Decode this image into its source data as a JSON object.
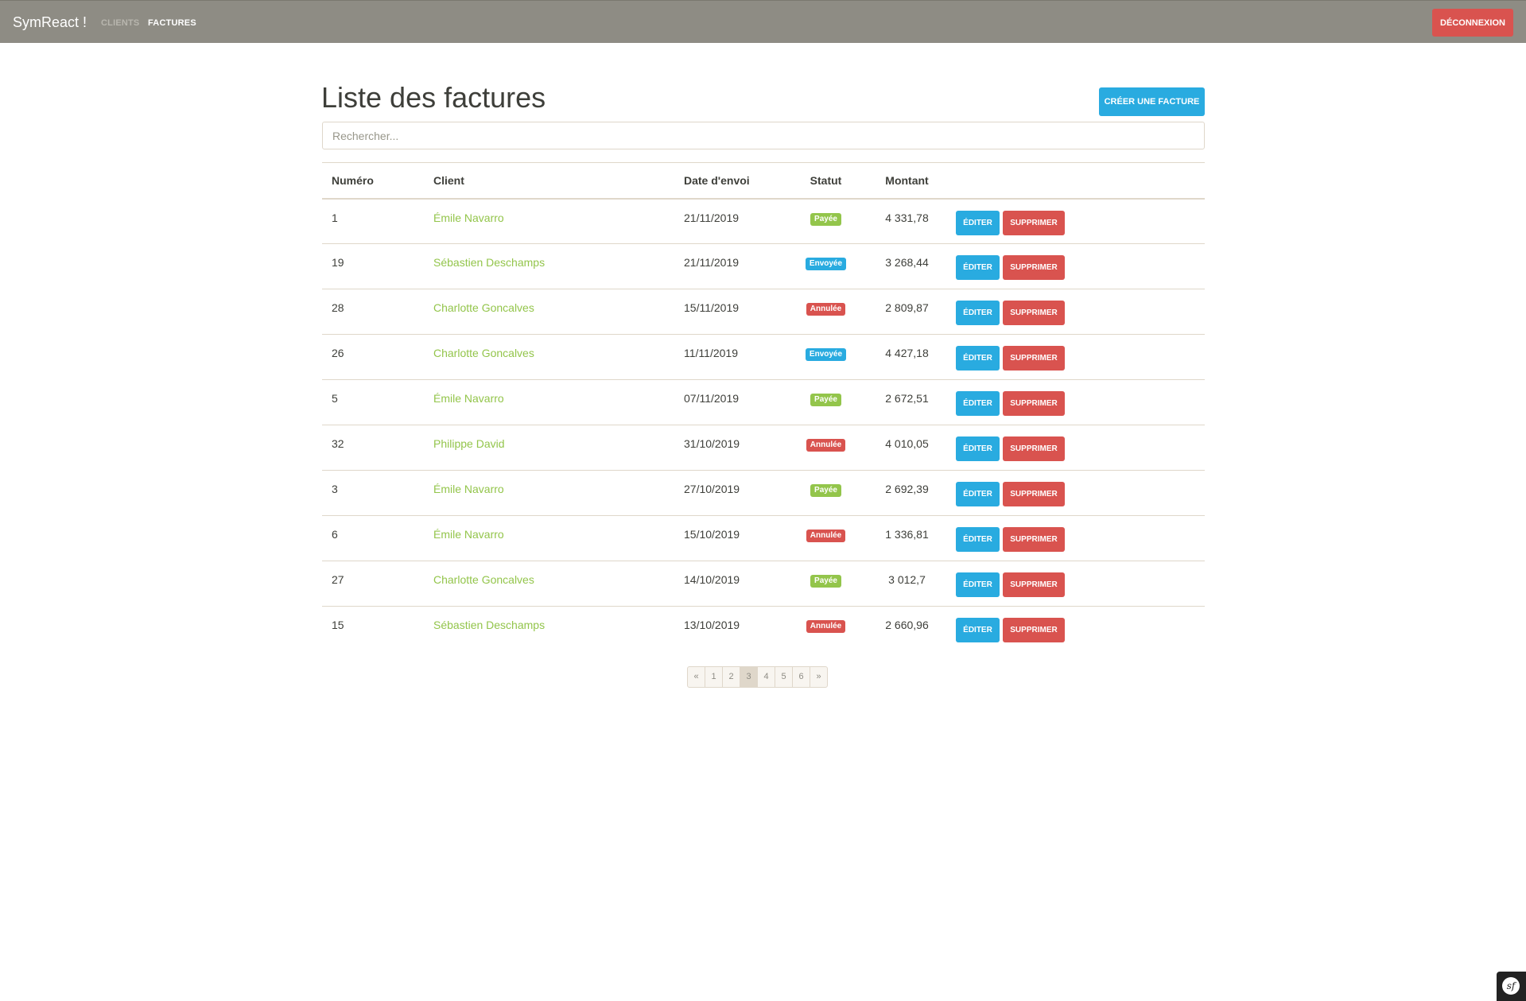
{
  "navbar": {
    "brand": "SymReact !",
    "links": [
      {
        "label": "Clients"
      },
      {
        "label": "Factures"
      }
    ],
    "logout_label": "Déconnexion"
  },
  "page": {
    "title": "Liste des factures",
    "create_label": "Créer une facture",
    "search_placeholder": "Rechercher..."
  },
  "table": {
    "headers": [
      "Numéro",
      "Client",
      "Date d'envoi",
      "Statut",
      "Montant",
      ""
    ],
    "edit_label": "Éditer",
    "delete_label": "Supprimer",
    "rows": [
      {
        "numero": "1",
        "client": "Émile Navarro",
        "date": "21/11/2019",
        "statut": "Payée",
        "statut_type": "paid",
        "montant": "4 331,78"
      },
      {
        "numero": "19",
        "client": "Sébastien Deschamps",
        "date": "21/11/2019",
        "statut": "Envoyée",
        "statut_type": "sent",
        "montant": "3 268,44"
      },
      {
        "numero": "28",
        "client": "Charlotte Goncalves",
        "date": "15/11/2019",
        "statut": "Annulée",
        "statut_type": "cancelled",
        "montant": "2 809,87"
      },
      {
        "numero": "26",
        "client": "Charlotte Goncalves",
        "date": "11/11/2019",
        "statut": "Envoyée",
        "statut_type": "sent",
        "montant": "4 427,18"
      },
      {
        "numero": "5",
        "client": "Émile Navarro",
        "date": "07/11/2019",
        "statut": "Payée",
        "statut_type": "paid",
        "montant": "2 672,51"
      },
      {
        "numero": "32",
        "client": "Philippe David",
        "date": "31/10/2019",
        "statut": "Annulée",
        "statut_type": "cancelled",
        "montant": "4 010,05"
      },
      {
        "numero": "3",
        "client": "Émile Navarro",
        "date": "27/10/2019",
        "statut": "Payée",
        "statut_type": "paid",
        "montant": "2 692,39"
      },
      {
        "numero": "6",
        "client": "Émile Navarro",
        "date": "15/10/2019",
        "statut": "Annulée",
        "statut_type": "cancelled",
        "montant": "1 336,81"
      },
      {
        "numero": "27",
        "client": "Charlotte Goncalves",
        "date": "14/10/2019",
        "statut": "Payée",
        "statut_type": "paid",
        "montant": "3 012,7"
      },
      {
        "numero": "15",
        "client": "Sébastien Deschamps",
        "date": "13/10/2019",
        "statut": "Annulée",
        "statut_type": "cancelled",
        "montant": "2 660,96"
      }
    ]
  },
  "pagination": {
    "prev": "«",
    "next": "»",
    "pages": [
      "1",
      "2",
      "3",
      "4",
      "5",
      "6"
    ],
    "current": "3"
  },
  "colors": {
    "navbar": "#8e8c84",
    "primary": "#29abe0",
    "danger": "#d9534f",
    "success": "#93c54b",
    "border": "#dfd7ca"
  },
  "icons": {
    "debug_toolbar": "symfony-logo-icon"
  }
}
